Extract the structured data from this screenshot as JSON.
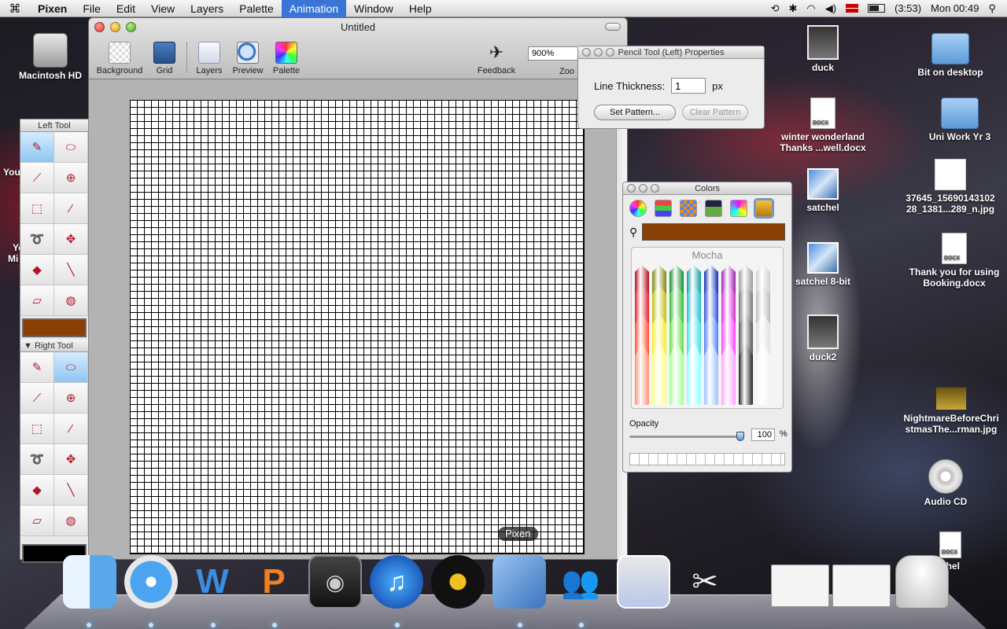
{
  "menubar": {
    "app": "Pixen",
    "items": [
      "File",
      "Edit",
      "View",
      "Layers",
      "Palette",
      "Animation",
      "Window",
      "Help"
    ],
    "active_item": "Animation",
    "battery": "(3:53)",
    "clock": "Mon 00:49"
  },
  "desktop": {
    "hd_label": "Macintosh HD",
    "icons": {
      "duck": "duck",
      "bit": "Bit on desktop",
      "winter1": "winter wonderland",
      "winter2": "Thanks ...well.docx",
      "uni": "Uni Work Yr 3",
      "satchel": "satchel",
      "photo1": "37645_15690143102",
      "photo2": "28_1381...289_n.jpg",
      "satchel8": "satchel 8-bit",
      "thankyou1": "Thank you for using",
      "thankyou2": "Booking.docx",
      "duck2": "duck2",
      "night1": "NightmareBeforeChri",
      "night2": "stmasThe...rman.jpg",
      "audio": "Audio CD",
      "satchel_partial": "chel"
    },
    "edge_texts": [
      "You",
      "Yo",
      "Mi"
    ]
  },
  "window": {
    "title": "Untitled",
    "toolbar": {
      "background": "Background",
      "grid": "Grid",
      "layers": "Layers",
      "preview": "Preview",
      "palette": "Palette",
      "feedback": "Feedback",
      "zoom_value": "900%",
      "zoom_label": "Zoo"
    }
  },
  "tools": {
    "left_header": "Left Tool",
    "right_header": "Right Tool",
    "left_color": "#8a3f05",
    "right_color": "#000000"
  },
  "props": {
    "title": "Pencil Tool (Left) Properties",
    "line_label": "Line Thickness:",
    "line_value": "1",
    "unit": "px",
    "set_pattern": "Set Pattern...",
    "clear_pattern": "Clear Pattern"
  },
  "colors": {
    "title": "Colors",
    "current_color": "#8a3f05",
    "crayon_name": "Mocha",
    "opacity_label": "Opacity",
    "opacity_value": "100",
    "opacity_unit": "%"
  },
  "dock": {
    "tooltip": "Pixen"
  }
}
